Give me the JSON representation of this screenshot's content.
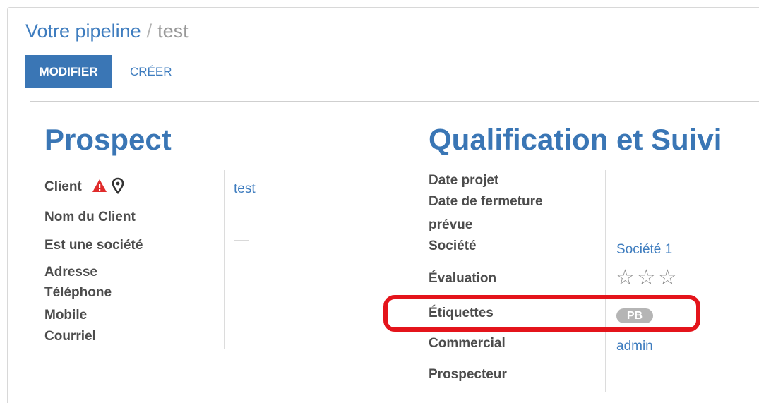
{
  "breadcrumb": {
    "parent": "Votre pipeline",
    "separator": "/",
    "current": "test"
  },
  "toolbar": {
    "edit_label": "MODIFIER",
    "create_label": "CRÉER"
  },
  "prospect": {
    "title": "Prospect",
    "client_label": "Client",
    "client_value": "test",
    "client_name_label": "Nom du Client",
    "is_company_label": "Est une société",
    "is_company_checked": false,
    "address_label": "Adresse",
    "phone_label": "Téléphone",
    "mobile_label": "Mobile",
    "email_label": "Courriel"
  },
  "qualification": {
    "title": "Qualification et Suivi",
    "project_date_label": "Date projet",
    "close_date_label_1": "Date de fermeture",
    "close_date_label_2": "prévue",
    "company_label": "Société",
    "company_value": "Société 1",
    "rating_label": "Évaluation",
    "rating_value": 0,
    "rating_max": 3,
    "tags_label": "Étiquettes",
    "tag_value": "PB",
    "salesperson_label": "Commercial",
    "salesperson_value": "admin",
    "prospector_label": "Prospecteur"
  },
  "icons": {
    "warning": "warning-icon",
    "location": "map-marker-icon",
    "star": "star-outline-icon"
  },
  "colors": {
    "primary": "#3a76b5",
    "link": "#3f7dbf",
    "warning": "#e02b2b",
    "highlight": "#e4141b",
    "tag": "#b5b5b5"
  }
}
